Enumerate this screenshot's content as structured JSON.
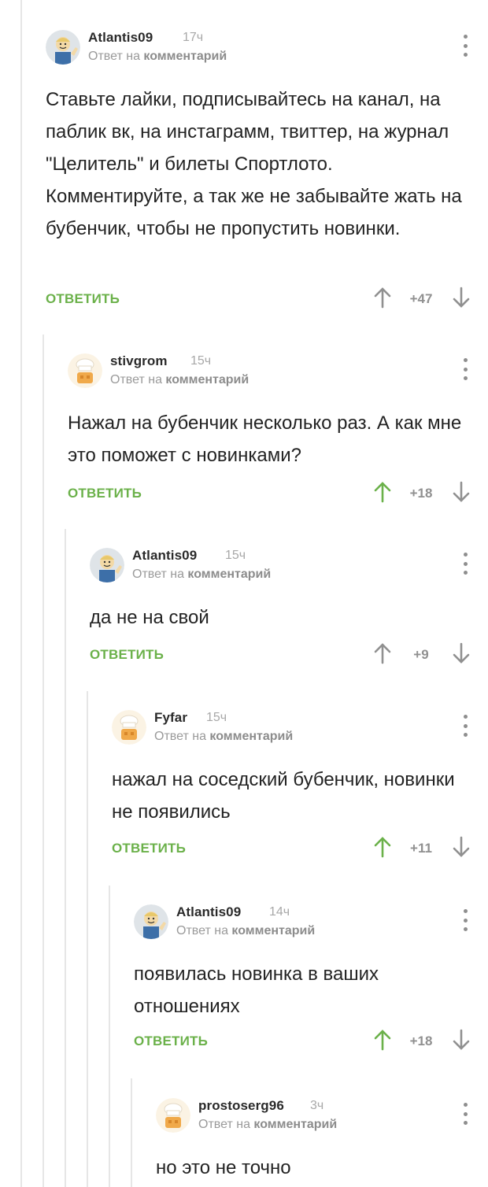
{
  "ui": {
    "reply_label": "ОТВЕТИТЬ",
    "reply_to_prefix": "Ответ на",
    "reply_to_target": "комментарий",
    "accent_color": "#6bb14a",
    "muted_color": "#909090"
  },
  "comments": [
    {
      "author": "Atlantis09",
      "time": "17ч",
      "avatar": "vault-boy-avatar",
      "text": "Ставьте лайки, подписывайтесь на канал, на паблик вк, на инстаграмм, твиттер, на журнал \"Целитель\" и билеты Спортлото. Комментируйте, а так же не забывайте жать на бубенчик, чтобы не пропустить новинки.",
      "rating": "+47",
      "upvoted": false
    },
    {
      "author": "stivgrom",
      "time": "15ч",
      "avatar": "chef-hat-avatar",
      "text": "Нажал на бубенчик несколько раз. А как мне это поможет с новинками?",
      "rating": "+18",
      "upvoted": true
    },
    {
      "author": "Atlantis09",
      "time": "15ч",
      "avatar": "vault-boy-avatar",
      "text": "да не на свой",
      "rating": "+9",
      "upvoted": false
    },
    {
      "author": "Fyfar",
      "time": "15ч",
      "avatar": "chef-hat-avatar",
      "text": "нажал на соседский бубенчик, новинки не появились",
      "rating": "+11",
      "upvoted": true
    },
    {
      "author": "Atlantis09",
      "time": "14ч",
      "avatar": "vault-boy-avatar",
      "text": "появилась новинка в ваших отношениях",
      "rating": "+18",
      "upvoted": true
    },
    {
      "author": "prostoserg96",
      "time": "3ч",
      "avatar": "chef-hat-avatar",
      "text": "но это не точно"
    }
  ]
}
